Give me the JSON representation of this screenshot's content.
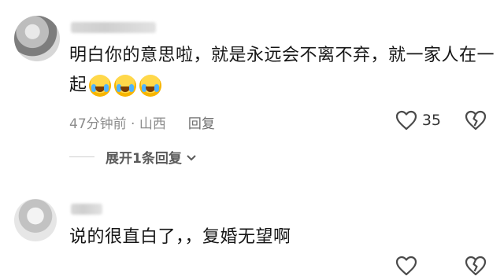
{
  "comments": [
    {
      "text": "明白你的意思啦，就是永远会不离不弃，就一家人在一起",
      "emojis": [
        "crying-laughing-emoji",
        "crying-laughing-emoji",
        "crying-laughing-emoji"
      ],
      "time_location": "47分钟前 · 山西",
      "reply_label": "回复",
      "like_count": "35",
      "expand_label": "展开1条回复"
    },
    {
      "text": "说的很直白了，，复婚无望啊"
    }
  ],
  "icons": {
    "like": "heart-outline-icon",
    "dislike": "broken-heart-icon",
    "expand": "chevron-down-icon"
  }
}
